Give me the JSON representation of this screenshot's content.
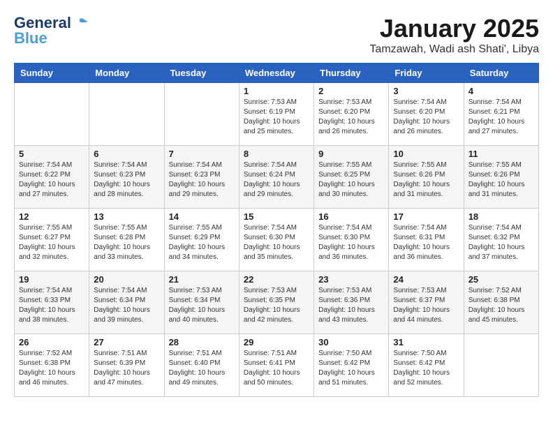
{
  "header": {
    "logo_line1": "General",
    "logo_line2": "Blue",
    "month_title": "January 2025",
    "location": "Tamzawah, Wadi ash Shati', Libya"
  },
  "days_of_week": [
    "Sunday",
    "Monday",
    "Tuesday",
    "Wednesday",
    "Thursday",
    "Friday",
    "Saturday"
  ],
  "weeks": [
    [
      {
        "date": "",
        "info": ""
      },
      {
        "date": "",
        "info": ""
      },
      {
        "date": "",
        "info": ""
      },
      {
        "date": "1",
        "info": "Sunrise: 7:53 AM\nSunset: 6:19 PM\nDaylight: 10 hours\nand 25 minutes."
      },
      {
        "date": "2",
        "info": "Sunrise: 7:53 AM\nSunset: 6:20 PM\nDaylight: 10 hours\nand 26 minutes."
      },
      {
        "date": "3",
        "info": "Sunrise: 7:54 AM\nSunset: 6:20 PM\nDaylight: 10 hours\nand 26 minutes."
      },
      {
        "date": "4",
        "info": "Sunrise: 7:54 AM\nSunset: 6:21 PM\nDaylight: 10 hours\nand 27 minutes."
      }
    ],
    [
      {
        "date": "5",
        "info": "Sunrise: 7:54 AM\nSunset: 6:22 PM\nDaylight: 10 hours\nand 27 minutes."
      },
      {
        "date": "6",
        "info": "Sunrise: 7:54 AM\nSunset: 6:23 PM\nDaylight: 10 hours\nand 28 minutes."
      },
      {
        "date": "7",
        "info": "Sunrise: 7:54 AM\nSunset: 6:23 PM\nDaylight: 10 hours\nand 29 minutes."
      },
      {
        "date": "8",
        "info": "Sunrise: 7:54 AM\nSunset: 6:24 PM\nDaylight: 10 hours\nand 29 minutes."
      },
      {
        "date": "9",
        "info": "Sunrise: 7:55 AM\nSunset: 6:25 PM\nDaylight: 10 hours\nand 30 minutes."
      },
      {
        "date": "10",
        "info": "Sunrise: 7:55 AM\nSunset: 6:26 PM\nDaylight: 10 hours\nand 31 minutes."
      },
      {
        "date": "11",
        "info": "Sunrise: 7:55 AM\nSunset: 6:26 PM\nDaylight: 10 hours\nand 31 minutes."
      }
    ],
    [
      {
        "date": "12",
        "info": "Sunrise: 7:55 AM\nSunset: 6:27 PM\nDaylight: 10 hours\nand 32 minutes."
      },
      {
        "date": "13",
        "info": "Sunrise: 7:55 AM\nSunset: 6:28 PM\nDaylight: 10 hours\nand 33 minutes."
      },
      {
        "date": "14",
        "info": "Sunrise: 7:55 AM\nSunset: 6:29 PM\nDaylight: 10 hours\nand 34 minutes."
      },
      {
        "date": "15",
        "info": "Sunrise: 7:54 AM\nSunset: 6:30 PM\nDaylight: 10 hours\nand 35 minutes."
      },
      {
        "date": "16",
        "info": "Sunrise: 7:54 AM\nSunset: 6:30 PM\nDaylight: 10 hours\nand 36 minutes."
      },
      {
        "date": "17",
        "info": "Sunrise: 7:54 AM\nSunset: 6:31 PM\nDaylight: 10 hours\nand 36 minutes."
      },
      {
        "date": "18",
        "info": "Sunrise: 7:54 AM\nSunset: 6:32 PM\nDaylight: 10 hours\nand 37 minutes."
      }
    ],
    [
      {
        "date": "19",
        "info": "Sunrise: 7:54 AM\nSunset: 6:33 PM\nDaylight: 10 hours\nand 38 minutes."
      },
      {
        "date": "20",
        "info": "Sunrise: 7:54 AM\nSunset: 6:34 PM\nDaylight: 10 hours\nand 39 minutes."
      },
      {
        "date": "21",
        "info": "Sunrise: 7:53 AM\nSunset: 6:34 PM\nDaylight: 10 hours\nand 40 minutes."
      },
      {
        "date": "22",
        "info": "Sunrise: 7:53 AM\nSunset: 6:35 PM\nDaylight: 10 hours\nand 42 minutes."
      },
      {
        "date": "23",
        "info": "Sunrise: 7:53 AM\nSunset: 6:36 PM\nDaylight: 10 hours\nand 43 minutes."
      },
      {
        "date": "24",
        "info": "Sunrise: 7:53 AM\nSunset: 6:37 PM\nDaylight: 10 hours\nand 44 minutes."
      },
      {
        "date": "25",
        "info": "Sunrise: 7:52 AM\nSunset: 6:38 PM\nDaylight: 10 hours\nand 45 minutes."
      }
    ],
    [
      {
        "date": "26",
        "info": "Sunrise: 7:52 AM\nSunset: 6:38 PM\nDaylight: 10 hours\nand 46 minutes."
      },
      {
        "date": "27",
        "info": "Sunrise: 7:51 AM\nSunset: 6:39 PM\nDaylight: 10 hours\nand 47 minutes."
      },
      {
        "date": "28",
        "info": "Sunrise: 7:51 AM\nSunset: 6:40 PM\nDaylight: 10 hours\nand 49 minutes."
      },
      {
        "date": "29",
        "info": "Sunrise: 7:51 AM\nSunset: 6:41 PM\nDaylight: 10 hours\nand 50 minutes."
      },
      {
        "date": "30",
        "info": "Sunrise: 7:50 AM\nSunset: 6:42 PM\nDaylight: 10 hours\nand 51 minutes."
      },
      {
        "date": "31",
        "info": "Sunrise: 7:50 AM\nSunset: 6:42 PM\nDaylight: 10 hours\nand 52 minutes."
      },
      {
        "date": "",
        "info": ""
      }
    ]
  ]
}
